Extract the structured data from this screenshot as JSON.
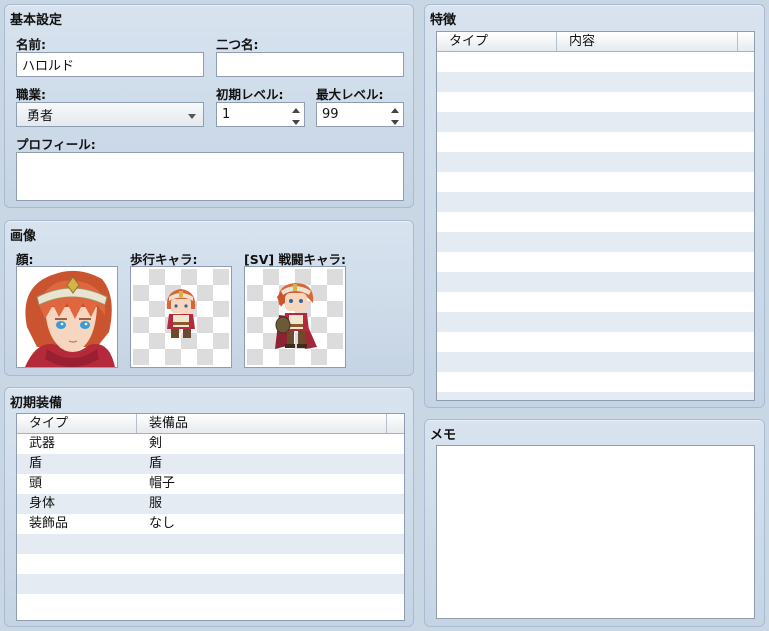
{
  "basic": {
    "title": "基本設定",
    "name_label": "名前:",
    "name_value": "ハロルド",
    "nickname_label": "二つ名:",
    "nickname_value": "",
    "class_label": "職業:",
    "class_value": "勇者",
    "initial_level_label": "初期レベル:",
    "initial_level_value": "1",
    "max_level_label": "最大レベル:",
    "max_level_value": "99",
    "profile_label": "プロフィール:",
    "profile_value": ""
  },
  "images": {
    "title": "画像",
    "face_label": "顔:",
    "walk_label": "歩行キャラ:",
    "battler_label": "[SV] 戦闘キャラ:"
  },
  "equipment": {
    "title": "初期装備",
    "columns": [
      "タイプ",
      "装備品"
    ],
    "rows": [
      {
        "type": "武器",
        "item": "剣"
      },
      {
        "type": "盾",
        "item": "盾"
      },
      {
        "type": "頭",
        "item": "帽子"
      },
      {
        "type": "身体",
        "item": "服"
      },
      {
        "type": "装飾品",
        "item": "なし"
      }
    ]
  },
  "traits": {
    "title": "特徴",
    "columns": [
      "タイプ",
      "内容"
    ]
  },
  "memo": {
    "title": "メモ",
    "value": ""
  },
  "colors": {
    "panel": "#c9d6e4",
    "row_alt": "#e4ebf3",
    "hair": "#d9653a",
    "scarf": "#b52a3a"
  }
}
